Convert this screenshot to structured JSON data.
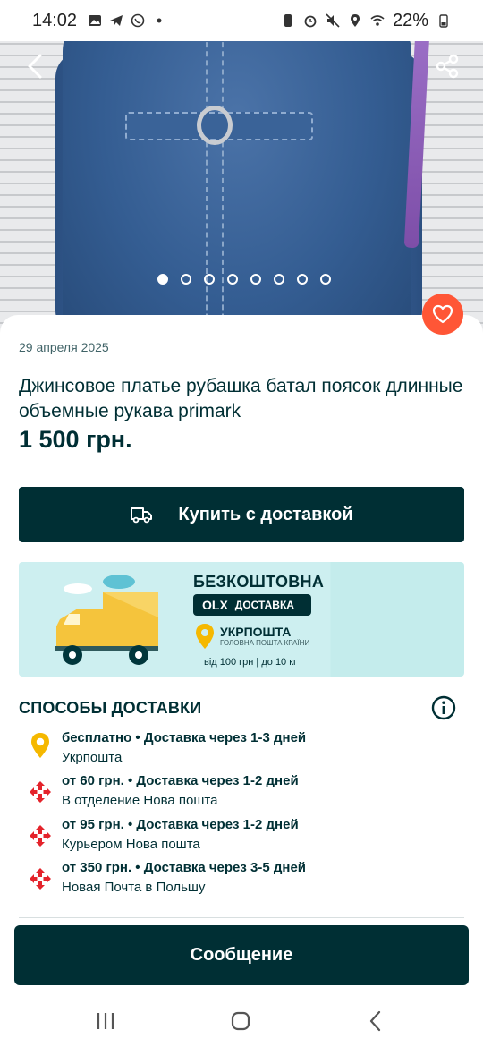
{
  "status": {
    "time": "14:02",
    "battery": "22%"
  },
  "gallery": {
    "dots_total": 8,
    "active_index": 0
  },
  "listing": {
    "date": "29 апреля 2025",
    "title": "Джинсовое платье рубашка батал поясок длинные объемные рукава primark",
    "price": "1 500 грн."
  },
  "actions": {
    "buy_with_delivery": "Купить с доставкой",
    "message": "Сообщение"
  },
  "banner": {
    "free": "БЕЗКОШТОВНА",
    "olx_mark": "OLX",
    "olx_delivery": "ДОСТАВКА",
    "ukrposhta": "УКРПОШТА",
    "ukrposhta_sub": "ГОЛОВНА ПОШТА КРАЇНИ",
    "range": "від 100 грн | до 10 кг"
  },
  "delivery": {
    "title": "СПОСОБЫ ДОСТАВКИ",
    "methods": [
      {
        "price": "бесплатно",
        "time": "Доставка через 1-3 дней",
        "carrier": "Укрпошта",
        "icon": "ukrposhta-pin-icon"
      },
      {
        "price": "от 60 грн.",
        "time": "Доставка через 1-2 дней",
        "carrier": "В отделение Нова пошта",
        "icon": "nova-poshta-icon"
      },
      {
        "price": "от 95 грн.",
        "time": "Доставка через 1-2 дней",
        "carrier": "Курьером Нова пошта",
        "icon": "nova-poshta-icon"
      },
      {
        "price": "от 350 грн.",
        "time": "Доставка через 3-5 дней",
        "carrier": "Новая Почта в Польшу",
        "icon": "nova-poshta-icon"
      }
    ]
  },
  "colors": {
    "primary_dark": "#002f34",
    "favorite": "#ff5636",
    "ukrposhta_yellow": "#f5b800",
    "nova_poshta_red": "#e4232b"
  }
}
